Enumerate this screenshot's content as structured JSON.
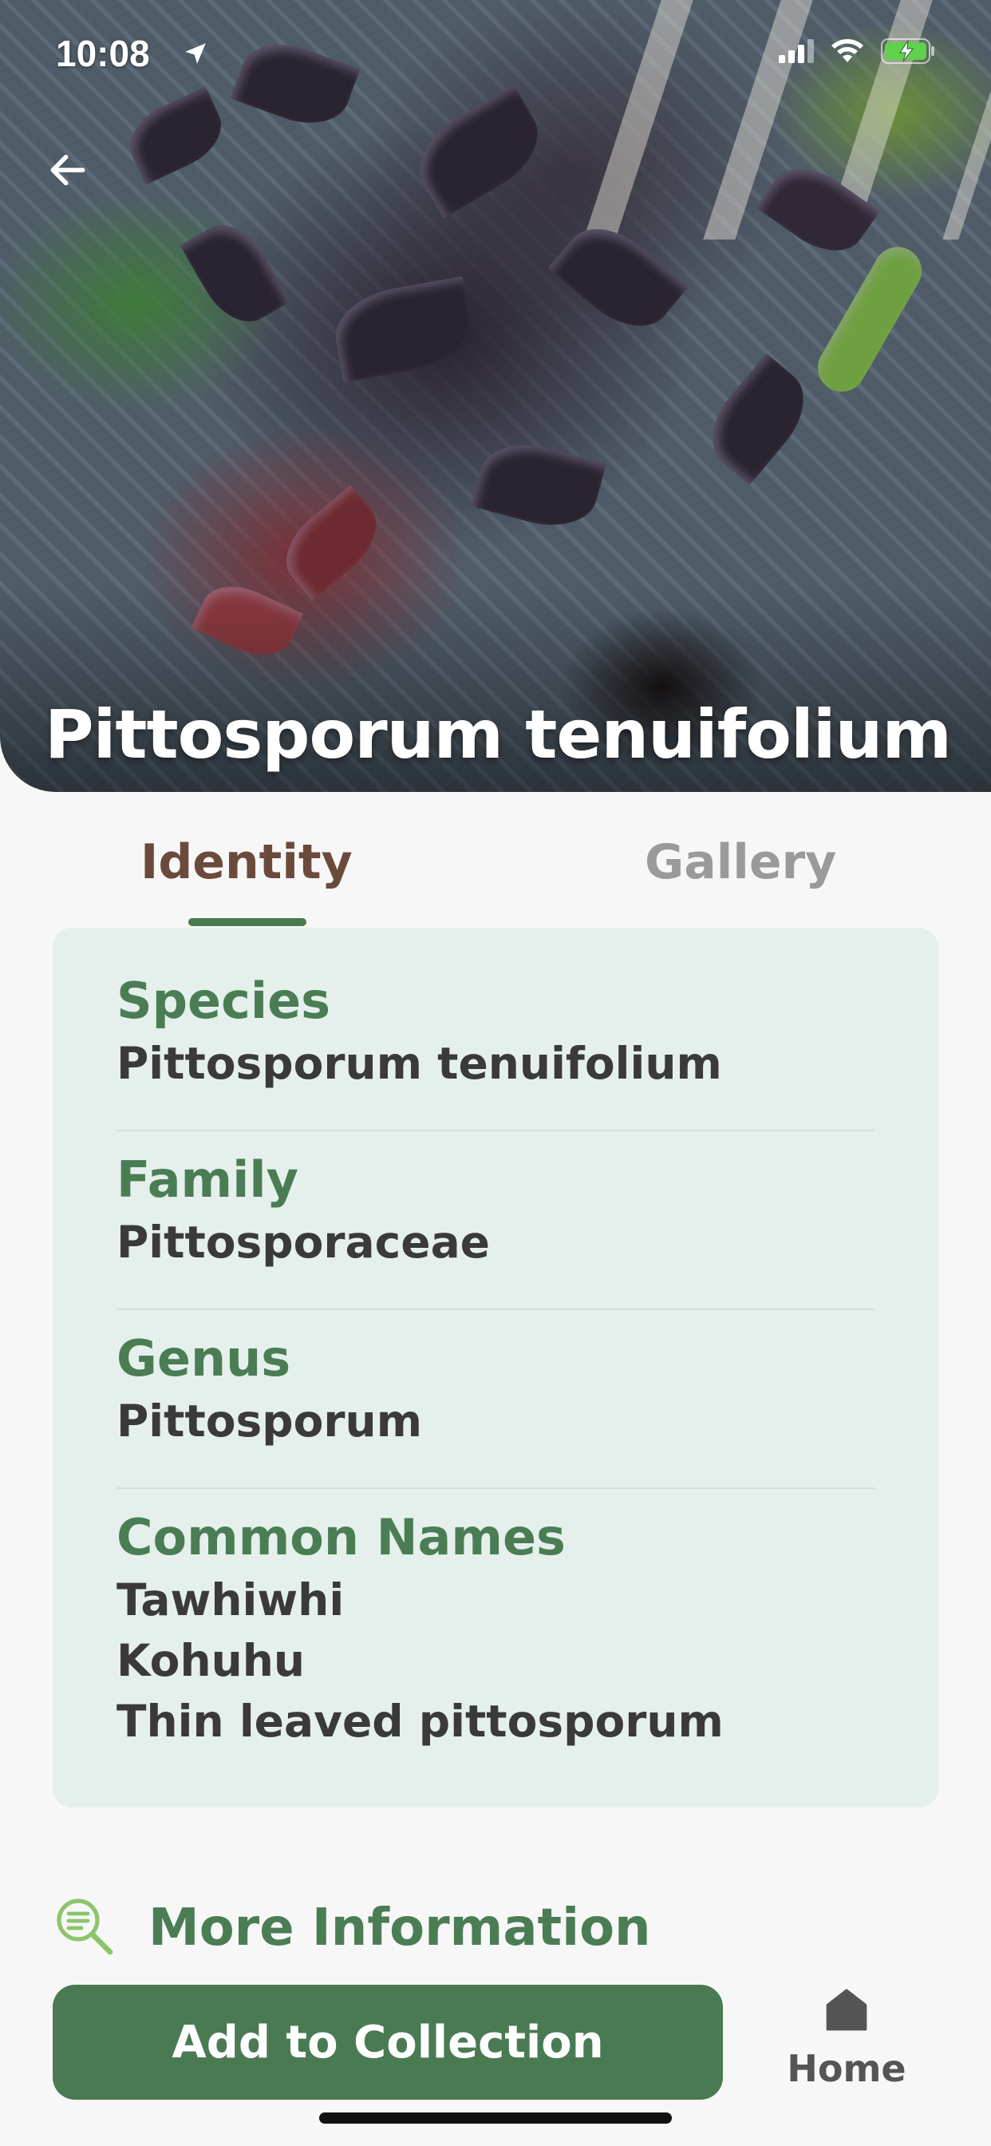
{
  "status_bar": {
    "time": "10:08",
    "icons": [
      "location-arrow-icon",
      "signal-icon",
      "wifi-icon",
      "battery-charging-icon"
    ]
  },
  "hero": {
    "title": "Pittosporum tenuifolium",
    "back_icon": "arrow-left-icon"
  },
  "tabs": [
    {
      "label": "Identity",
      "active": true
    },
    {
      "label": "Gallery",
      "active": false
    }
  ],
  "identity": {
    "species": {
      "label": "Species",
      "value": "Pittosporum tenuifolium"
    },
    "family": {
      "label": "Family",
      "value": "Pittosporaceae"
    },
    "genus": {
      "label": "Genus",
      "value": "Pittosporum"
    },
    "common_names": {
      "label": "Common Names",
      "values": [
        "Tawhiwhi",
        "Kohuhu",
        "Thin leaved pittosporum"
      ]
    }
  },
  "more_info": {
    "label": "More Information",
    "icon": "search-text-icon"
  },
  "bottom": {
    "add_button_label": "Add to Collection",
    "home_label": "Home",
    "home_icon": "home-icon"
  },
  "colors": {
    "primary_green": "#4a7a52",
    "label_green": "#4b7d55",
    "active_tab_brown": "#6b4a3c",
    "inactive_tab_gray": "#9a9a9a",
    "card_background": "#e5f0ec",
    "page_background": "#f7f7f7",
    "icon_light_green": "#8cc56a"
  }
}
